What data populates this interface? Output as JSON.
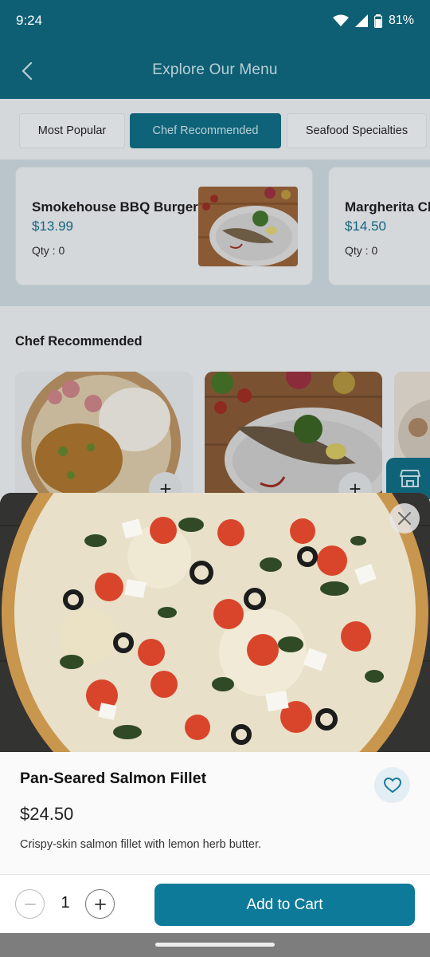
{
  "status": {
    "time": "9:24",
    "battery": "81%"
  },
  "appbar": {
    "title": "Explore Our Menu"
  },
  "tabs": [
    {
      "label": "Most Popular"
    },
    {
      "label": "Chef Recommended"
    },
    {
      "label": "Seafood Specialties"
    }
  ],
  "strip_cards": [
    {
      "name": "Smokehouse BBQ Burger",
      "price": "$13.99",
      "qty": "Qty : 0"
    },
    {
      "name": "Margherita Cl",
      "price": "$14.50",
      "qty": "Qty : 0"
    }
  ],
  "section": {
    "title": "Chef Recommended"
  },
  "product": {
    "name": "Pan-Seared Salmon Fillet",
    "price": "$24.50",
    "description": "Crispy-skin salmon fillet with lemon herb butter.",
    "quantity": "1"
  },
  "cart": {
    "add_label": "Add to Cart"
  },
  "colors": {
    "primary": "#0d7a9a",
    "appbar_dim": "#0f5f74",
    "price_text": "#16657c"
  }
}
